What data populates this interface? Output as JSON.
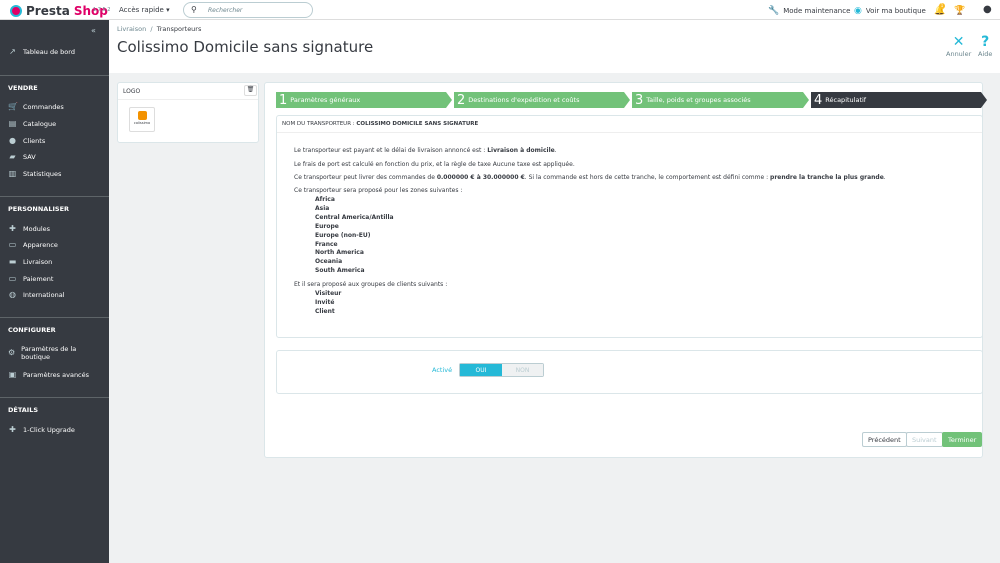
{
  "topbar": {
    "brand_a": "Presta",
    "brand_b": "Shop",
    "version": "1.7.5.2",
    "quick_access": "Accès rapide ▾",
    "search_placeholder": "Rechercher",
    "maintenance": "Mode maintenance",
    "view_shop": "Voir ma boutique",
    "notif_count": "1"
  },
  "sidebar": {
    "dashboard": "Tableau de bord",
    "sections": [
      {
        "title": "VENDRE",
        "items": [
          "Commandes",
          "Catalogue",
          "Clients",
          "SAV",
          "Statistiques"
        ]
      },
      {
        "title": "PERSONNALISER",
        "items": [
          "Modules",
          "Apparence",
          "Livraison",
          "Paiement",
          "International"
        ]
      },
      {
        "title": "CONFIGURER",
        "items": [
          "Paramètres de la boutique",
          "Paramètres avancés"
        ]
      },
      {
        "title": "DÉTAILS",
        "items": [
          "1-Click Upgrade"
        ]
      }
    ]
  },
  "header": {
    "breadcrumb": [
      "Livraison",
      "Transporteurs"
    ],
    "title": "Colissimo Domicile sans signature",
    "cancel": "Annuler",
    "help": "Aide"
  },
  "logo_panel": {
    "title": "LOGO",
    "logo_text": "colissimo"
  },
  "steps": [
    {
      "n": "1",
      "label": "Paramètres généraux"
    },
    {
      "n": "2",
      "label": "Destinations d'expédition et coûts"
    },
    {
      "n": "3",
      "label": "Taille, poids et groupes associés"
    },
    {
      "n": "4",
      "label": "Récapitulatif"
    }
  ],
  "summary": {
    "name_label": "NOM DU TRANSPORTEUR : ",
    "name": "COLISSIMO DOMICILE SANS SIGNATURE",
    "l1a": "Le transporteur est payant et le délai de livraison annoncé est : ",
    "l1b": "Livraison à domicile",
    "l2": "Le frais de port est calculé en fonction du prix, et la règle de taxe Aucune taxe est appliquée.",
    "l3a": "Ce transporteur peut livrer des commandes de ",
    "l3b": "0.000000 € à 30.000000 €",
    "l3c": ". Si la commande est hors de cette tranche, le comportement est défini comme : ",
    "l3d": "prendre la tranche la plus grande",
    "zones_label": "Ce transporteur sera proposé pour les zones suivantes :",
    "zones": [
      "Africa",
      "Asia",
      "Central America/Antilla",
      "Europe",
      "Europe (non-EU)",
      "France",
      "North America",
      "Oceania",
      "South America"
    ],
    "groups_label": "Et il sera proposé aux groupes de clients suivants :",
    "groups": [
      "Visiteur",
      "Invité",
      "Client"
    ]
  },
  "active": {
    "label": "Activé",
    "yes": "OUI",
    "no": "NON"
  },
  "footer": {
    "prev": "Précédent",
    "next": "Suivant",
    "finish": "Terminer"
  }
}
